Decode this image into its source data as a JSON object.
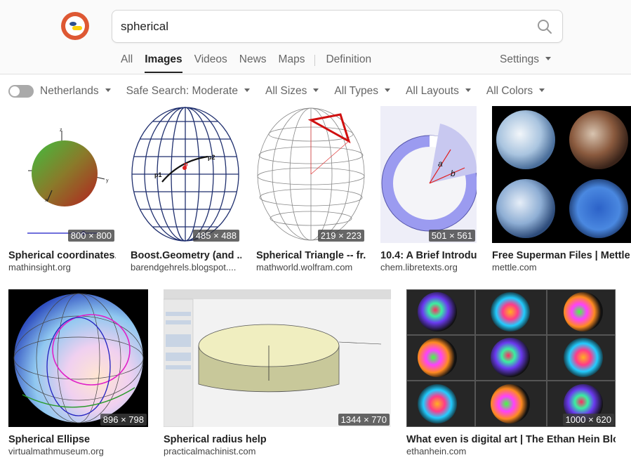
{
  "search": {
    "query": "spherical"
  },
  "nav": {
    "tabs": [
      "All",
      "Images",
      "Videos",
      "News",
      "Maps"
    ],
    "definition": "Definition",
    "settings": "Settings"
  },
  "filters": {
    "region": "Netherlands",
    "safe_search": "Safe Search: Moderate",
    "sizes": "All Sizes",
    "types": "All Types",
    "layouts": "All Layouts",
    "colors": "All Colors"
  },
  "results": [
    {
      "title": "Spherical coordinates...",
      "domain": "mathinsight.org",
      "dimensions": "800 × 800"
    },
    {
      "title": "Boost.Geometry (and ...",
      "domain": "barendgehrels.blogspot....",
      "dimensions": "485 × 488"
    },
    {
      "title": "Spherical Triangle -- fr...",
      "domain": "mathworld.wolfram.com",
      "dimensions": "219 × 223"
    },
    {
      "title": "10.4: A Brief Introdu...",
      "domain": "chem.libretexts.org",
      "dimensions": "501 × 561"
    },
    {
      "title": "Free Superman Files | Mettle",
      "domain": "mettle.com",
      "dimensions": ""
    },
    {
      "title": "Spherical Ellipse",
      "domain": "virtualmathmuseum.org",
      "dimensions": "896 × 798"
    },
    {
      "title": "Spherical radius help",
      "domain": "practicalmachinist.com",
      "dimensions": "1344 × 770"
    },
    {
      "title": "What even is digital art | The Ethan Hein Blog",
      "domain": "ethanhein.com",
      "dimensions": "1000 × 620"
    }
  ],
  "thumb_labels": {
    "r1": [
      "z",
      "y",
      "x"
    ],
    "r2": [
      "p",
      "p1",
      "p2"
    ],
    "r4": [
      "a",
      "b"
    ]
  },
  "colors": {
    "accent": "#de5833",
    "text": "#222222",
    "muted": "#666666"
  }
}
